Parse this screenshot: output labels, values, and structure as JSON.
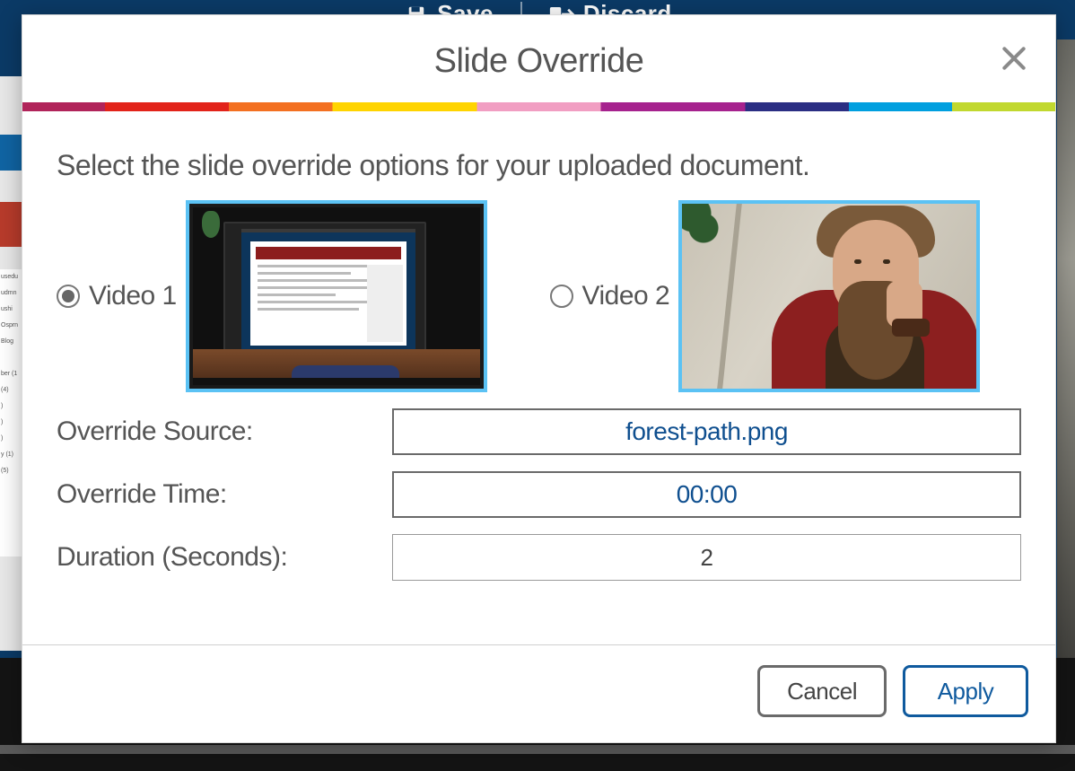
{
  "background_toolbar": {
    "save_label": "Save",
    "discard_label": "Discard"
  },
  "modal": {
    "title": "Slide Override",
    "prompt": "Select the slide override options for your uploaded document.",
    "video_choices": [
      {
        "label": "Video 1",
        "selected": true
      },
      {
        "label": "Video 2",
        "selected": false
      }
    ],
    "fields": {
      "override_source": {
        "label": "Override Source:",
        "value": "forest-path.png"
      },
      "override_time": {
        "label": "Override Time:",
        "value": "00:00"
      },
      "duration": {
        "label": "Duration (Seconds):",
        "value": "2"
      }
    },
    "buttons": {
      "cancel": "Cancel",
      "apply": "Apply"
    }
  }
}
